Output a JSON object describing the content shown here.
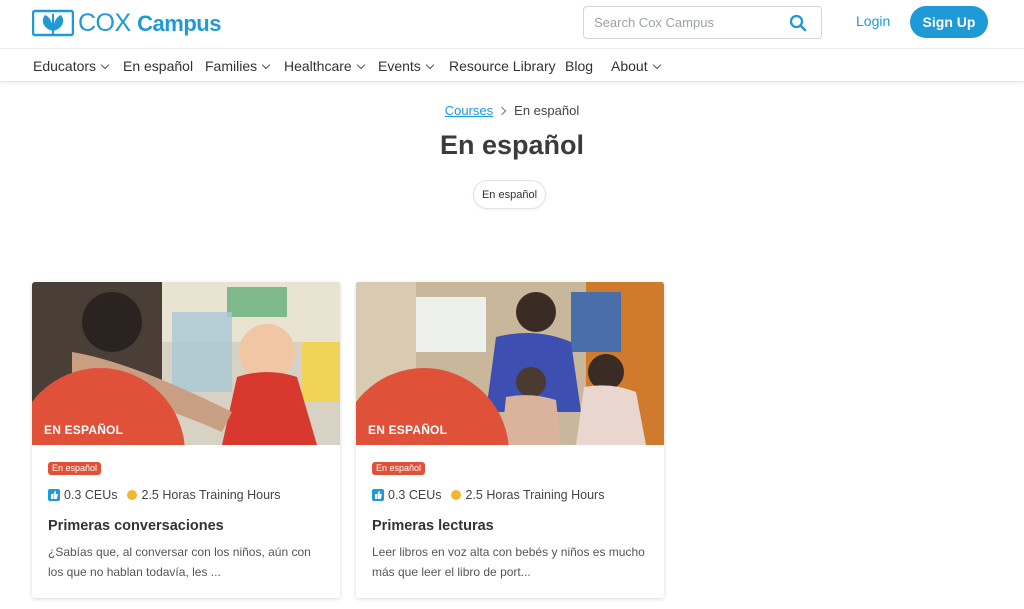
{
  "header": {
    "logo_cox": "COX",
    "logo_campus": "Campus",
    "search_placeholder": "Search Cox Campus",
    "login": "Login",
    "signup": "Sign Up"
  },
  "nav": {
    "items": [
      {
        "label": "Educators",
        "dropdown": true
      },
      {
        "label": "En español",
        "dropdown": false
      },
      {
        "label": "Families",
        "dropdown": true
      },
      {
        "label": "Healthcare",
        "dropdown": true
      },
      {
        "label": "Events",
        "dropdown": true
      },
      {
        "label": "Resource Library",
        "dropdown": false
      },
      {
        "label": "Blog",
        "dropdown": false
      },
      {
        "label": "About",
        "dropdown": true
      }
    ]
  },
  "breadcrumb": {
    "parent": "Courses",
    "current": "En español"
  },
  "page": {
    "title": "En español",
    "filter_pill": "En español"
  },
  "cards": [
    {
      "ribbon": "EN ESPAÑOL",
      "tag": "En español",
      "ceus": "0.3 CEUs",
      "hours": "2.5 Horas Training Hours",
      "title": "Primeras conversaciones",
      "description": "¿Sabías que, al conversar con los niños, aún con los que no hablan todavía, les ..."
    },
    {
      "ribbon": "EN ESPAÑOL",
      "tag": "En español",
      "ceus": "0.3 CEUs",
      "hours": "2.5 Horas Training Hours",
      "title": "Primeras lecturas",
      "description": "Leer libros en voz alta con bebés y niños es mucho más que leer el libro de port..."
    }
  ],
  "colors": {
    "brand_blue": "#1e9ad6",
    "accent_red": "#e0513a",
    "hours_yellow": "#f2b632"
  }
}
